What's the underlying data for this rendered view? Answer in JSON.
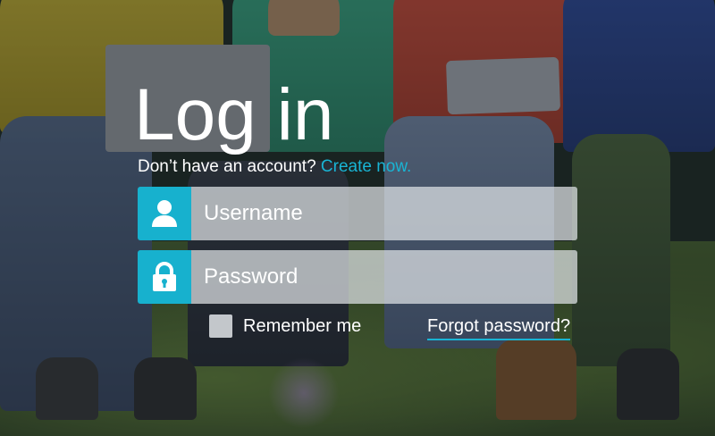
{
  "login": {
    "title": "Log in",
    "signup_prompt": "Don’t have an account?",
    "signup_link": "Create now.",
    "username_placeholder": "Username",
    "password_placeholder": "Password",
    "remember_label": "Remember me",
    "remember_checked": false,
    "forgot_link": "Forgot password?",
    "icons": {
      "username": "user-icon",
      "password": "lock-icon"
    }
  },
  "colors": {
    "accent": "#17b1ce",
    "text": "#ffffff",
    "field_bg": "#e1e4e8"
  }
}
